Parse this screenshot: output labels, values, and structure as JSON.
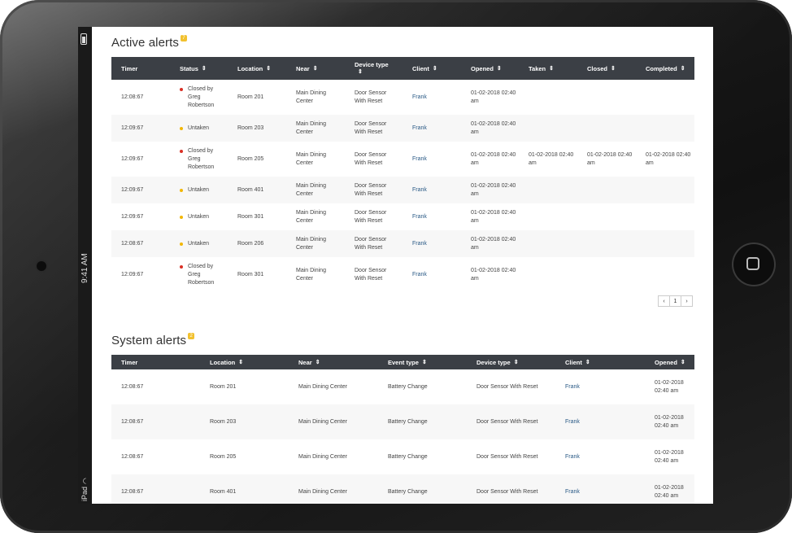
{
  "device": {
    "status_time": "9:41 AM",
    "status_carrier": "iPad"
  },
  "colors": {
    "header_bg": "#3b3f45",
    "badge": "#f2c12e",
    "closed": "#d93025",
    "untaken": "#f2b705",
    "link": "#2a5a86"
  },
  "active": {
    "title": "Active alerts",
    "badge": "7",
    "columns": [
      "Timer",
      "Status",
      "Location",
      "Near",
      "Device type",
      "Client",
      "Opened",
      "Taken",
      "Closed",
      "Completed"
    ],
    "rows": [
      {
        "timer": "12:08:67",
        "status": "Closed by Greg Robertson",
        "status_kind": "closed",
        "location": "Room 201",
        "near": "Main Dining Center",
        "device": "Door Sensor With Reset",
        "client": "Frank",
        "opened": "01-02-2018 02:40 am",
        "taken": "",
        "closed": "",
        "completed": ""
      },
      {
        "timer": "12:09:67",
        "status": "Untaken",
        "status_kind": "untaken",
        "location": "Room 203",
        "near": "Main Dining Center",
        "device": "Door Sensor With Reset",
        "client": "Frank",
        "opened": "01-02-2018 02:40 am",
        "taken": "",
        "closed": "",
        "completed": ""
      },
      {
        "timer": "12:09:67",
        "status": "Closed by Greg Robertson",
        "status_kind": "closed",
        "location": "Room 205",
        "near": "Main Dining Center",
        "device": "Door Sensor With Reset",
        "client": "Frank",
        "opened": "01-02-2018 02:40 am",
        "taken": "01-02-2018 02:40 am",
        "closed": "01-02-2018 02:40 am",
        "completed": "01-02-2018 02:40 am"
      },
      {
        "timer": "12:09:67",
        "status": "Untaken",
        "status_kind": "untaken",
        "location": "Room 401",
        "near": "Main Dining Center",
        "device": "Door Sensor With Reset",
        "client": "Frank",
        "opened": "01-02-2018 02:40 am",
        "taken": "",
        "closed": "",
        "completed": ""
      },
      {
        "timer": "12:09:67",
        "status": "Untaken",
        "status_kind": "untaken",
        "location": "Room 301",
        "near": "Main Dining Center",
        "device": "Door Sensor With Reset",
        "client": "Frank",
        "opened": "01-02-2018 02:40 am",
        "taken": "",
        "closed": "",
        "completed": ""
      },
      {
        "timer": "12:08:67",
        "status": "Untaken",
        "status_kind": "untaken",
        "location": "Room 206",
        "near": "Main Dining Center",
        "device": "Door Sensor With Reset",
        "client": "Frank",
        "opened": "01-02-2018 02:40 am",
        "taken": "",
        "closed": "",
        "completed": ""
      },
      {
        "timer": "12:09:67",
        "status": "Closed by Greg Robertson",
        "status_kind": "closed",
        "location": "Room 301",
        "near": "Main Dining Center",
        "device": "Door Sensor With Reset",
        "client": "Frank",
        "opened": "01-02-2018 02:40 am",
        "taken": "",
        "closed": "",
        "completed": ""
      }
    ],
    "pager": {
      "prev": "‹",
      "page": "1",
      "next": "›"
    }
  },
  "system": {
    "title": "System alerts",
    "badge": "2",
    "columns": [
      "Timer",
      "Location",
      "Near",
      "Event type",
      "Device type",
      "Client",
      "Opened"
    ],
    "rows": [
      {
        "timer": "12:08:67",
        "location": "Room 201",
        "near": "Main Dining Center",
        "event": "Battery Change",
        "device": "Door Sensor With Reset",
        "client": "Frank",
        "opened": "01-02-2018 02:40 am"
      },
      {
        "timer": "12:08:67",
        "location": "Room 203",
        "near": "Main Dining Center",
        "event": "Battery Change",
        "device": "Door Sensor With Reset",
        "client": "Frank",
        "opened": "01-02-2018 02:40 am"
      },
      {
        "timer": "12:08:67",
        "location": "Room 205",
        "near": "Main Dining Center",
        "event": "Battery Change",
        "device": "Door Sensor With Reset",
        "client": "Frank",
        "opened": "01-02-2018 02:40 am"
      },
      {
        "timer": "12:08:67",
        "location": "Room 401",
        "near": "Main Dining Center",
        "event": "Battery Change",
        "device": "Door Sensor With Reset",
        "client": "Frank",
        "opened": "01-02-2018 02:40 am"
      }
    ]
  }
}
